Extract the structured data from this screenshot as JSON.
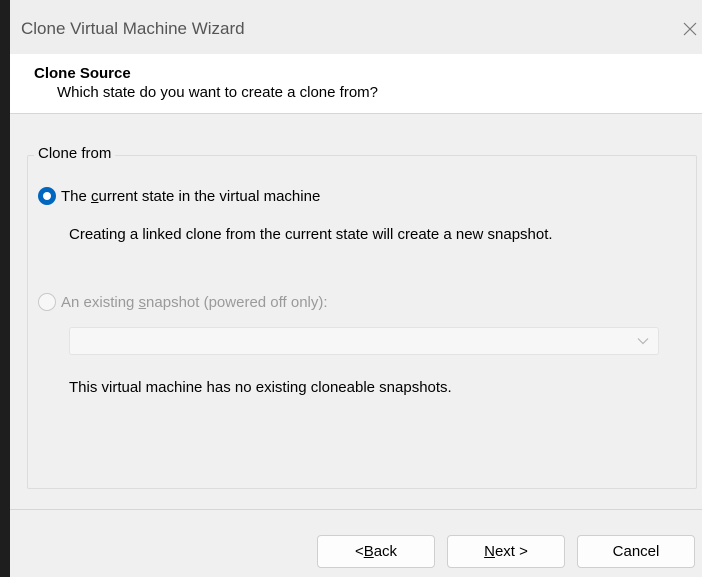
{
  "window": {
    "title": "Clone Virtual Machine Wizard"
  },
  "header": {
    "title": "Clone Source",
    "subtitle": "Which state do you want to create a clone from?"
  },
  "group": {
    "legend": "Clone from",
    "option_current": {
      "label_pre": "The ",
      "label_accel": "c",
      "label_post": "urrent state in the virtual machine",
      "selected": true,
      "description": "Creating a linked clone from the current state will create a new snapshot."
    },
    "option_snapshot": {
      "label_pre": "An existing ",
      "label_accel": "s",
      "label_post": "napshot (powered off only):",
      "selected": false,
      "enabled": false,
      "select_value": "",
      "note": "This virtual machine has no existing cloneable snapshots."
    }
  },
  "buttons": {
    "back": {
      "pre": "< ",
      "accel": "B",
      "post": "ack"
    },
    "next": {
      "pre": "",
      "accel": "N",
      "post": "ext >"
    },
    "cancel": {
      "label": "Cancel"
    }
  },
  "colors": {
    "accent": "#0067c0",
    "disabled_text": "#9a9a9a"
  },
  "icons": {
    "close": "close-icon",
    "dropdown": "chevron-down-icon"
  }
}
